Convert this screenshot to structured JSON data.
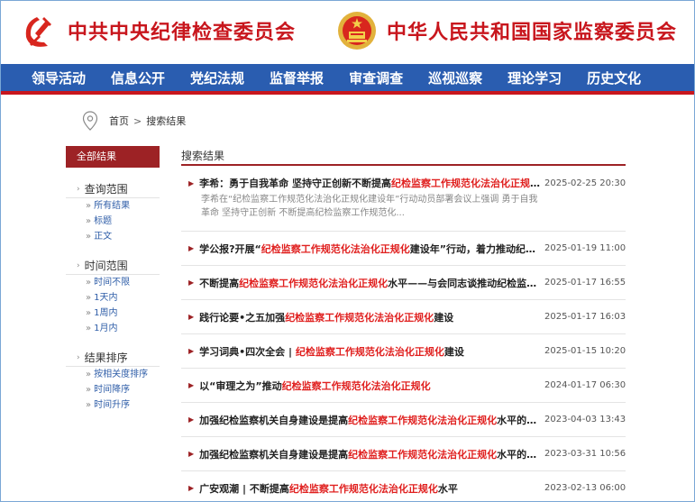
{
  "header": {
    "left_title": "中共中央纪律检查委员会",
    "right_title": "中华人民共和国国家监察委员会",
    "colors": {
      "brand_red": "#c8161d",
      "nav_blue": "#2a5db0",
      "accent_red": "#9d2225"
    }
  },
  "nav": [
    {
      "label": "领导活动"
    },
    {
      "label": "信息公开"
    },
    {
      "label": "党纪法规"
    },
    {
      "label": "监督举报"
    },
    {
      "label": "审查调查"
    },
    {
      "label": "巡视巡察"
    },
    {
      "label": "理论学习"
    },
    {
      "label": "历史文化"
    }
  ],
  "breadcrumb": {
    "home": "首页",
    "separator": ">",
    "current": "搜索结果"
  },
  "sidebar": {
    "header": "全部结果",
    "groups": [
      {
        "title": "查询范围",
        "options": [
          "所有结果",
          "标题",
          "正文"
        ]
      },
      {
        "title": "时间范围",
        "options": [
          "时间不限",
          "1天内",
          "1周内",
          "1月内"
        ]
      },
      {
        "title": "结果排序",
        "options": [
          "按相关度排序",
          "时间降序",
          "时间升序"
        ]
      }
    ]
  },
  "results": {
    "header": "搜索结果",
    "items": [
      {
        "pre": "李希：勇于自我革命 坚持守正创新不断提高",
        "hl": "纪检监察工作规范化法治化正规化",
        "post": "...",
        "date": "2025-02-25 20:30",
        "snippet": "李希在“纪检监察工作规范化法治化正规化建设年”行动动员部署会议上强调  勇于自我革命 坚持守正创新  不断提高纪检监察工作规范化..."
      },
      {
        "pre": "学公报?开展“",
        "hl": "纪检监察工作规范化法治化正规化",
        "post": "建设年”行动，着力推动纪检...",
        "date": "2025-01-19 11:00"
      },
      {
        "pre": "不断提高",
        "hl": "纪检监察工作规范化法治化正规化",
        "post": "水平——与会同志谈推动纪检监察...",
        "date": "2025-01-17 16:55"
      },
      {
        "pre": "践行论要•之五加强",
        "hl": "纪检监察工作规范化法治化正规化",
        "post": "建设",
        "date": "2025-01-17 16:03"
      },
      {
        "pre": "学习词典•四次全会 | ",
        "hl": "纪检监察工作规范化法治化正规化",
        "post": "建设",
        "date": "2025-01-15 10:20"
      },
      {
        "pre": "以“审理之为”推动",
        "hl": "纪检监察工作规范化法治化正规化",
        "post": "",
        "date": "2024-01-17 06:30"
      },
      {
        "pre": "加强纪检监察机关自身建设是提高",
        "hl": "纪检监察工作规范化法治化正规化",
        "post": "水平的内...",
        "date": "2023-04-03 13:43"
      },
      {
        "pre": "加强纪检监察机关自身建设是提高",
        "hl": "纪检监察工作规范化法治化正规化",
        "post": "水平的内...",
        "date": "2023-03-31 10:56"
      },
      {
        "pre": "广安观潮 | 不断提高",
        "hl": "纪检监察工作规范化法治化正规化",
        "post": "水平",
        "date": "2023-02-13 06:00"
      }
    ]
  }
}
